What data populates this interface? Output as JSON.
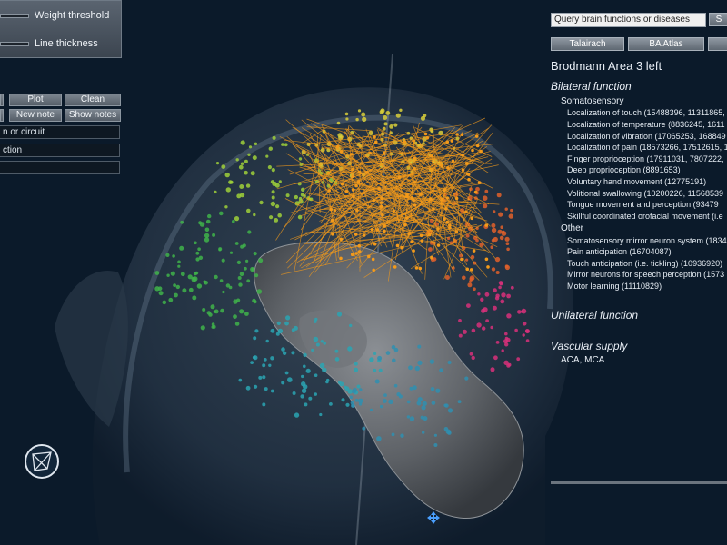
{
  "controls": {
    "weight_threshold": "Weight threshold",
    "line_thickness": "Line thickness",
    "buttons": [
      "Plot",
      "Clean",
      "New note",
      "Show notes"
    ],
    "field1": "n or circuit",
    "field2": "ction",
    "field3": ""
  },
  "query": {
    "placeholder": "Query brain functions or diseases",
    "search_label": "S"
  },
  "atlas_tabs": [
    "Talairach",
    "BA Atlas"
  ],
  "info": {
    "title": "Brodmann Area 3 left",
    "bilateral": "Bilateral function",
    "somatosensory": "Somatosensory",
    "somato_items": [
      "Localization of touch (15488396, 11311865, 1",
      "Localization of temperature (8836245, 1611",
      "Localization of vibration (17065253, 168849",
      "Localization of pain (18573266, 17512615, 1",
      "Finger proprioception (17911031, 7807222,",
      "Deep proprioception (8891653)",
      "Voluntary hand movement (12775191)",
      "Volitional swallowing (10200226, 11568539",
      "Tongue movement and perception  (93479",
      "Skillful coordinated orofacial movement (i.e"
    ],
    "other": "Other",
    "other_items": [
      "Somatosensory mirror neuron system (1834",
      "Pain anticipation  (16704087)",
      "Touch anticipation (i.e. tickling) (10936920)",
      "Mirror neurons for speech perception (1573",
      "Motor learning (11110829)"
    ],
    "unilateral": "Unilateral function",
    "vascular": "Vascular supply",
    "vascular_value": "ACA, MCA"
  },
  "colors": {
    "background": "#0b1a2a",
    "connection": "#f39a1a",
    "brain": "#6b6f73"
  },
  "icons": [
    "app-logo-icon",
    "move-arrows-icon"
  ]
}
